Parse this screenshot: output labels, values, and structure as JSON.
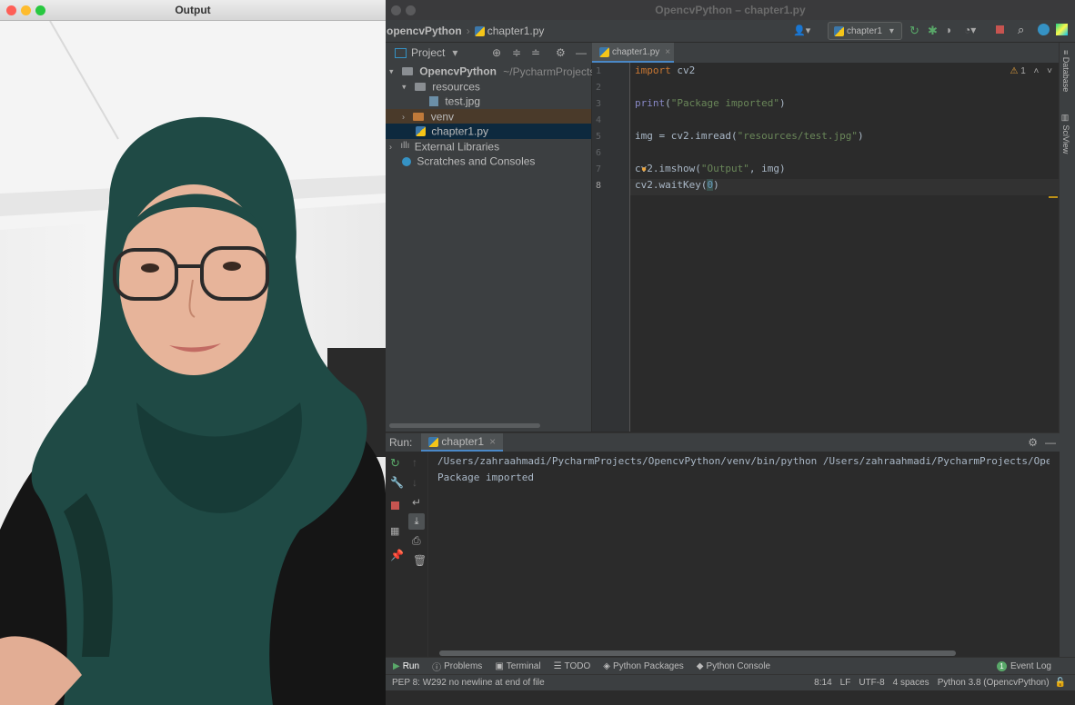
{
  "output_window": {
    "title": "Output",
    "image_name": "test.jpg"
  },
  "ide": {
    "window_title": "OpencvPython – chapter1.py",
    "breadcrumb": {
      "project": "opencvPython",
      "file": "chapter1.py"
    },
    "run_config": "chapter1",
    "project_panel": {
      "title": "Project",
      "root_name": "OpencvPython",
      "root_path": "~/PycharmProjects/O",
      "items": [
        {
          "label": "resources"
        },
        {
          "label": "test.jpg"
        },
        {
          "label": "venv"
        },
        {
          "label": "chapter1.py"
        },
        {
          "label": "External Libraries"
        },
        {
          "label": "Scratches and Consoles"
        }
      ]
    },
    "editor": {
      "tab_label": "chapter1.py",
      "warning_count": "1",
      "line_numbers": [
        "1",
        "2",
        "3",
        "4",
        "5",
        "6",
        "7",
        "8"
      ],
      "lines": [
        {
          "kw": "import",
          "rest": " cv2"
        },
        {
          "text": ""
        },
        {
          "fn": "print",
          "open": "(",
          "str": "\"Package imported\"",
          "close": ")"
        },
        {
          "text": ""
        },
        {
          "pre": "img = cv2.imread(",
          "str": "\"resources/test.jpg\"",
          "close": ")"
        },
        {
          "text": ""
        },
        {
          "pre": "cv2.imshow(",
          "str": "\"Output\"",
          "close": ", img)"
        },
        {
          "pre": "cv2.waitKey(",
          "num": "0",
          "close": ")"
        }
      ]
    },
    "right_bar": {
      "database": "Database",
      "sciview": "SciView"
    },
    "run_panel": {
      "label": "Run:",
      "tab": "chapter1",
      "output_lines": [
        "/Users/zahraahmadi/PycharmProjects/OpencvPython/venv/bin/python /Users/zahraahmadi/PycharmProjects/Opencv",
        "Package imported"
      ]
    },
    "bottom_tabs": [
      "Run",
      "Problems",
      "Terminal",
      "TODO",
      "Python Packages",
      "Python Console"
    ],
    "event_log": {
      "count": "1",
      "label": "Event Log"
    },
    "status": {
      "message": "PEP 8: W292 no newline at end of file",
      "position": "8:14",
      "line_sep": "LF",
      "encoding": "UTF-8",
      "indent": "4 spaces",
      "interpreter": "Python 3.8 (OpencvPython)"
    }
  },
  "colors": {
    "keyword": "#cc7832",
    "string": "#6a8759",
    "builtin": "#8888c6",
    "number": "#6897bb",
    "selected_row": "#0d293e",
    "excluded_row": "#4a3a2a",
    "run_green": "#59a869",
    "stop_red": "#c75450"
  }
}
